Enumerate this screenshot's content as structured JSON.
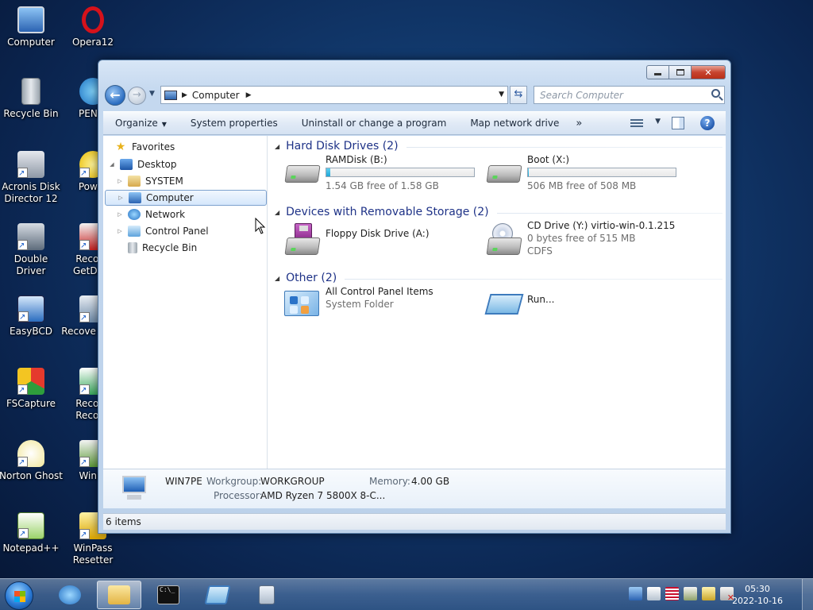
{
  "desktop": {
    "icons": [
      {
        "label": "Computer"
      },
      {
        "label": "Opera12"
      },
      {
        "label": "Recycle Bin"
      },
      {
        "label": "PENet"
      },
      {
        "label": "Acronis Disk Director 12"
      },
      {
        "label": "Power"
      },
      {
        "label": "Double Driver"
      },
      {
        "label": "Recove GetData"
      },
      {
        "label": "EasyBCD"
      },
      {
        "label": "Recove MiniT"
      },
      {
        "label": "FSCapture"
      },
      {
        "label": "Recove Recove"
      },
      {
        "label": "Norton Ghost"
      },
      {
        "label": "WinDi"
      },
      {
        "label": "Notepad++"
      },
      {
        "label": "WinPass Resetter"
      }
    ]
  },
  "window": {
    "address": {
      "crumbs": [
        "Computer"
      ],
      "search_placeholder": "Search Computer"
    },
    "commandbar": {
      "organize": "Organize",
      "system_properties": "System properties",
      "uninstall": "Uninstall or change a program",
      "map_drive": "Map network drive",
      "more": "»"
    },
    "nav": {
      "favorites": "Favorites",
      "desktop": "Desktop",
      "items": [
        "SYSTEM",
        "Computer",
        "Network",
        "Control Panel",
        "Recycle Bin"
      ]
    },
    "groups": {
      "hdd": "Hard Disk Drives (2)",
      "removable": "Devices with Removable Storage (2)",
      "other": "Other (2)"
    },
    "drives": {
      "ramdisk": {
        "name": "RAMDisk (B:)",
        "free": "1.54 GB free of 1.58 GB",
        "used_fraction": 0.025
      },
      "boot": {
        "name": "Boot (X:)",
        "free": "506 MB free of 508 MB",
        "used_fraction": 0.004
      },
      "floppy": {
        "name": "Floppy Disk Drive (A:)"
      },
      "cd": {
        "name": "CD Drive (Y:) virtio-win-0.1.215",
        "free": "0 bytes free of 515 MB",
        "fs": "CDFS"
      },
      "cpl": {
        "name": "All Control Panel Items",
        "sub": "System Folder"
      },
      "run": {
        "name": "Run..."
      }
    },
    "details": {
      "computer_name": "WIN7PE",
      "workgroup_label": "Workgroup:",
      "workgroup": "WORKGROUP",
      "memory_label": "Memory:",
      "memory": "4.00 GB",
      "processor_label": "Processor:",
      "processor": "AMD Ryzen 7 5800X 8-C..."
    },
    "status": "6 items"
  },
  "taskbar": {
    "time": "05:30",
    "date": "2022-10-16"
  }
}
